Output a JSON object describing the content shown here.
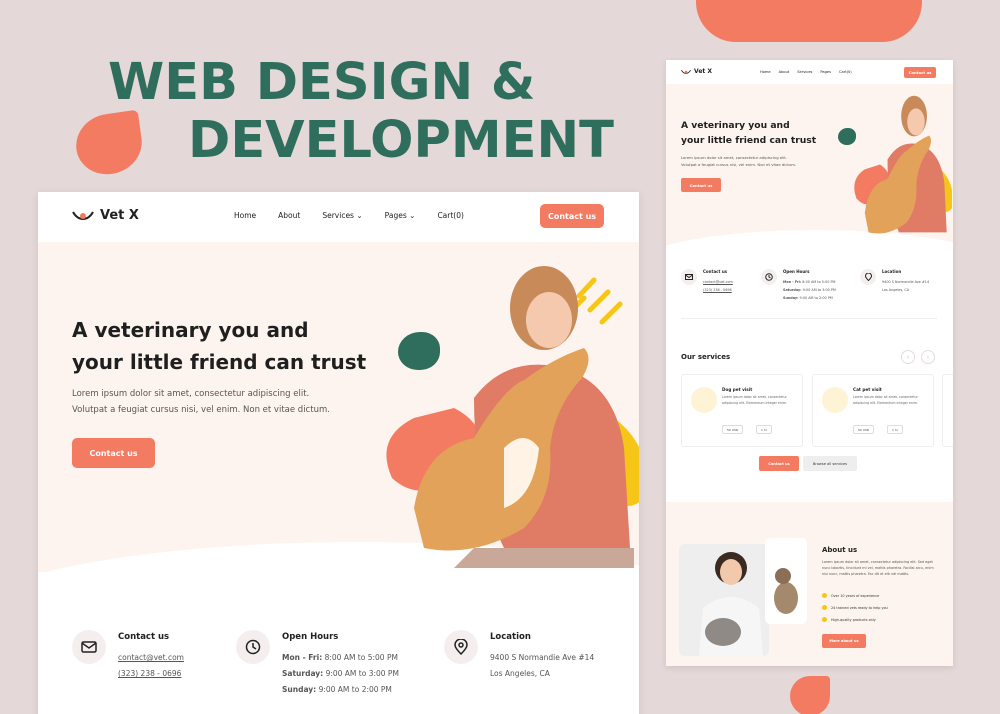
{
  "headline": {
    "line1": "WEB DESIGN &",
    "line2": "DEVELOPMENT"
  },
  "site": {
    "brand": "Vet X",
    "nav": [
      "Home",
      "About",
      "Services",
      "Pages",
      "Cart(0)"
    ],
    "contact_button": "Contact us",
    "hero_title_line1": "A veterinary you and",
    "hero_title_line2": "your little friend can trust",
    "hero_sub_line1": "Lorem ipsum dolor sit amet, consectetur adipiscing elit.",
    "hero_sub_line2": "Volutpat a feugiat cursus nisi, vel enim. Non et vitae dictum.",
    "hero_button": "Contact us",
    "contact": {
      "title": "Contact us",
      "email": "contact@vet.com",
      "phone": "(323) 238 - 0696"
    },
    "hours": {
      "title": "Open Hours",
      "l1_day": "Mon - Fri:",
      "l1_time": "8:00 AM to 5:00 PM",
      "l2_day": "Saturday:",
      "l2_time": "9:00 AM to 3:00 PM",
      "l3_day": "Sunday:",
      "l3_time": "9:00 AM to 2:00 PM"
    },
    "location": {
      "title": "Location",
      "line1": "9400 S Normandie Ave #14",
      "line2": "Los Angeles, CA"
    },
    "services": {
      "title": "Our services",
      "cards": [
        {
          "title": "Dog pet visit",
          "desc": "Lorem ipsum dolor sit amet, consectetur adipiscing elit. Elementum integer enim.",
          "price": "50 USD",
          "duration": "1 hr"
        },
        {
          "title": "Cat pet visit",
          "desc": "Lorem ipsum dolor sit amet, consectetur adipiscing elit. Elementum integer enim.",
          "price": "50 USD",
          "duration": "1 hr"
        }
      ],
      "contact_button": "Contact us",
      "browse_button": "Browse all services"
    },
    "about": {
      "title": "About us",
      "text": "Lorem ipsum dolor sit amet, consectetur adipiscing elit. Sed eget nunc lobortis, tincidunt mi vel, mattis pharetra. Facilisi arcu, enim nisi nunc, mattis pharetra. Fac dlt et elit ndl mattis.",
      "checks": [
        "Over 10 years of experience",
        "24 trained vets ready to help you",
        "High-quality products only"
      ],
      "button": "More about us"
    }
  },
  "colors": {
    "accent": "#f37b62",
    "green": "#2f6d5c",
    "hero_bg": "#fdf4ef",
    "yellow": "#f5c518",
    "page_bg": "#e5d8d8"
  }
}
